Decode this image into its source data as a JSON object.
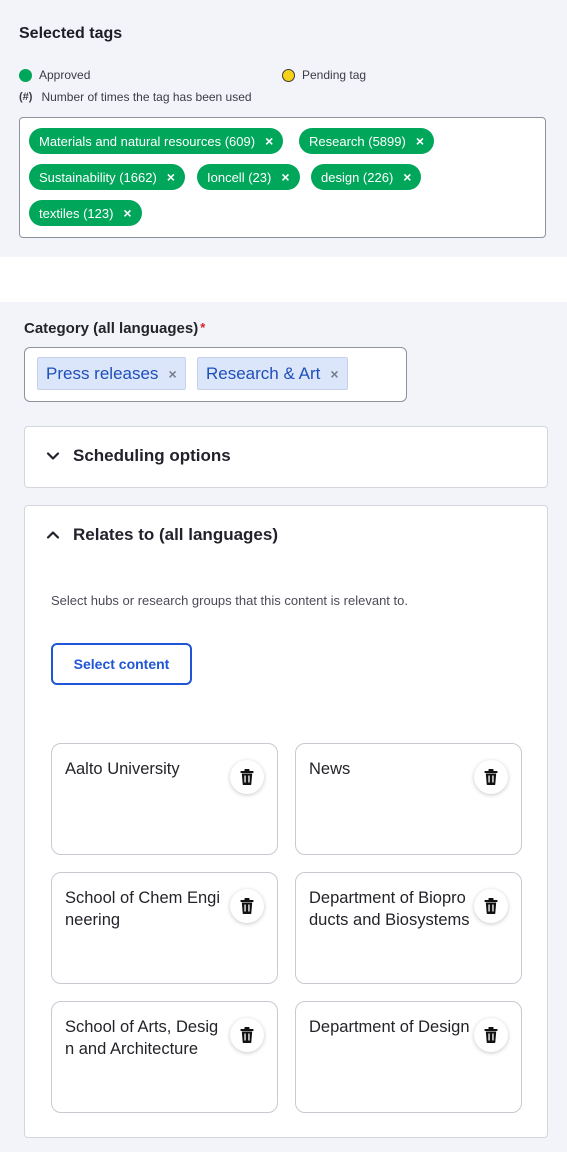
{
  "selected_tags": {
    "title": "Selected tags",
    "legend": {
      "approved": "Approved",
      "pending": "Pending tag",
      "count_symbol": "(#)",
      "count_text": "Number of times the tag has been used"
    },
    "tags": [
      {
        "label": "Materials and natural resources (609)",
        "status": "approved"
      },
      {
        "label": "Research (5899)",
        "status": "approved"
      },
      {
        "label": "Sustainability (1662)",
        "status": "approved"
      },
      {
        "label": "Ioncell (23)",
        "status": "approved"
      },
      {
        "label": "design (226)",
        "status": "approved"
      },
      {
        "label": "textiles (123)",
        "status": "approved"
      }
    ],
    "remove_symbol": "×"
  },
  "category": {
    "label": "Category (all languages)",
    "required_mark": "*",
    "chips": [
      "Press releases",
      "Research & Art"
    ],
    "remove_symbol": "×"
  },
  "scheduling": {
    "title": "Scheduling options",
    "expanded": false
  },
  "relates": {
    "title": "Relates to (all languages)",
    "expanded": true,
    "description": "Select hubs or research groups that this content is relevant to.",
    "select_button": "Select content",
    "items": [
      "Aalto University",
      "News",
      "School of Chem Engineering",
      "Department of Bioproducts and Biosystems",
      "School of Arts, Design and Architecture",
      "Department of Design"
    ]
  },
  "colors": {
    "approved": "#00a65a",
    "pending": "#f5d117",
    "primary": "#1f55d6",
    "required": "#d72222",
    "chip_bg": "#dbe6fb"
  },
  "icons": {
    "approved": "green-dot-icon",
    "pending": "yellow-dot-icon",
    "remove": "close-icon",
    "collapsed": "chevron-down-icon",
    "expanded": "chevron-up-icon",
    "delete": "trash-icon"
  }
}
